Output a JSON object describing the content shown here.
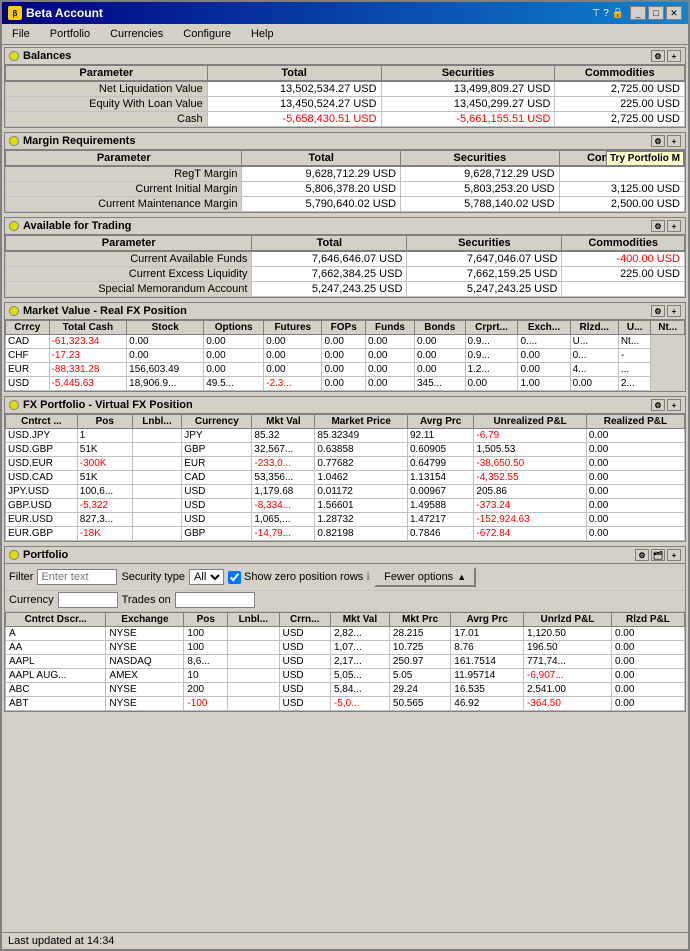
{
  "window": {
    "title": "Beta Account",
    "icon": "β"
  },
  "menu": {
    "items": [
      "File",
      "Portfolio",
      "Currencies",
      "Configure",
      "Help"
    ]
  },
  "balances": {
    "title": "Balances",
    "headers": [
      "Parameter",
      "Total",
      "Securities",
      "Commodities"
    ],
    "rows": [
      [
        "Net Liquidation Value",
        "13,502,534.27 USD",
        "13,499,809.27 USD",
        "2,725.00 USD"
      ],
      [
        "Equity With Loan Value",
        "13,450,524.27 USD",
        "13,450,299.27 USD",
        "225.00 USD"
      ],
      [
        "Cash",
        "-5,658,430.51 USD",
        "-5,661,155.51 USD",
        "2,725.00 USD"
      ]
    ]
  },
  "margin": {
    "title": "Margin Requirements",
    "headers": [
      "Parameter",
      "Total",
      "Securities",
      "Commodities"
    ],
    "try_portfolio": "Try Portfolio M",
    "rows": [
      [
        "RegT Margin",
        "9,628,712.29 USD",
        "9,628,712.29 USD",
        ""
      ],
      [
        "Current Initial Margin",
        "5,806,378.20 USD",
        "5,803,253.20 USD",
        "3,125.00 USD"
      ],
      [
        "Current Maintenance Margin",
        "5,790,640.02 USD",
        "5,788,140.02 USD",
        "2,500.00 USD"
      ]
    ]
  },
  "available": {
    "title": "Available for Trading",
    "headers": [
      "Parameter",
      "Total",
      "Securities",
      "Commodities"
    ],
    "rows": [
      [
        "Current Available Funds",
        "7,646,646.07 USD",
        "7,647,046.07 USD",
        "-400.00 USD"
      ],
      [
        "Current Excess Liquidity",
        "7,662,384.25 USD",
        "7,662,159.25 USD",
        "225.00 USD"
      ],
      [
        "Special Memorandum Account",
        "5,247,243.25 USD",
        "5,247,243.25 USD",
        ""
      ]
    ]
  },
  "market_value": {
    "title": "Market Value - Real FX Position",
    "headers": [
      "Crrcy",
      "Total Cash",
      "Stock",
      "Options",
      "Futures",
      "FOPs",
      "Funds",
      "Bonds",
      "Crprt...",
      "Exch...",
      "Rlzd...",
      "U...",
      "Nt..."
    ],
    "rows": [
      [
        "CAD",
        "-61,323.34",
        "0.00",
        "0.00",
        "0.00",
        "0.00",
        "0.00",
        "0.00",
        "0.9...",
        "0....",
        "U...",
        "Nt..."
      ],
      [
        "CHF",
        "-17.23",
        "0.00",
        "0.00",
        "0.00",
        "0.00",
        "0.00",
        "0.00",
        "0.9...",
        "0.00",
        "0...",
        "-"
      ],
      [
        "EUR",
        "-88,331.28",
        "156,603.49",
        "0.00",
        "0.00",
        "0.00",
        "0.00",
        "0.00",
        "1.2...",
        "0.00",
        "4...",
        "..."
      ],
      [
        "USD",
        "-5,445.63",
        "18,906.9...",
        "49.5...",
        "-2.3...",
        "0.00",
        "0.00",
        "345...",
        "0.00",
        "1.00",
        "0.00",
        "2...",
        "..."
      ]
    ]
  },
  "fx_portfolio": {
    "title": "FX Portfolio - Virtual FX Position",
    "headers": [
      "Cntrct ...",
      "Pos",
      "Lnbl...",
      "Currency",
      "Mkt Val",
      "Market Price",
      "Avrg Prc",
      "Unrealized P&L",
      "Realized P&L"
    ],
    "rows": [
      [
        "USD.JPY",
        "1",
        "",
        "JPY",
        "85.32",
        "85.32349",
        "92.11",
        "-6.79",
        "0.00"
      ],
      [
        "USD.GBP",
        "51K",
        "",
        "GBP",
        "32,567...",
        "0.63858",
        "0.60905",
        "1,505.53",
        "0.00"
      ],
      [
        "USD.EUR",
        "-300K",
        "",
        "EUR",
        "-233,0...",
        "0.77682",
        "0.64799",
        "-38,650.50",
        "0.00"
      ],
      [
        "USD.CAD",
        "51K",
        "",
        "CAD",
        "53,356...",
        "1.0462",
        "1.13154",
        "-4,352.55",
        "0.00"
      ],
      [
        "JPY.USD",
        "100,6...",
        "",
        "USD",
        "1,179.68",
        "0.01172",
        "0.00967",
        "205.86",
        "0.00"
      ],
      [
        "GBP.USD",
        "-5,322",
        "",
        "USD",
        "-8,334...",
        "1.56601",
        "1.49588",
        "-373.24",
        "0.00"
      ],
      [
        "EUR.USD",
        "827,3...",
        "",
        "USD",
        "1,065,...",
        "1.28732",
        "1.47217",
        "-152,924.63",
        "0.00"
      ],
      [
        "EUR.GBP",
        "-18K",
        "",
        "GBP",
        "-14,79...",
        "0.82198",
        "0.7846",
        "-672.84",
        "0.00"
      ]
    ]
  },
  "portfolio": {
    "title": "Portfolio",
    "filter": {
      "filter_label": "Filter",
      "filter_placeholder": "Enter text",
      "security_type_label": "Security type",
      "security_type_value": "All",
      "show_zero_label": "Show zero position rows",
      "currency_label": "Currency",
      "trades_on_label": "Trades on",
      "fewer_options_label": "Fewer options"
    },
    "headers": [
      "Cntrct Dscr...",
      "Exchange",
      "Pos",
      "Lnbl...",
      "Crrn...",
      "Mkt Val",
      "Mkt Prc",
      "Avrg Prc",
      "Unrlzd P&L",
      "Rlzd P&L"
    ],
    "rows": [
      [
        "A",
        "NYSE",
        "100",
        "",
        "USD",
        "2,82...",
        "28.215",
        "17.01",
        "1,120.50",
        "0.00"
      ],
      [
        "AA",
        "NYSE",
        "100",
        "",
        "USD",
        "1,07...",
        "10.725",
        "8.76",
        "196.50",
        "0.00"
      ],
      [
        "AAPL",
        "NASDAQ",
        "8,6...",
        "",
        "USD",
        "2,17...",
        "250.97",
        "161.7514",
        "771,74...",
        "0.00"
      ],
      [
        "AAPL AUG...",
        "AMEX",
        "10",
        "",
        "USD",
        "5,05...",
        "5.05",
        "11.95714",
        "-6,907...",
        "0.00"
      ],
      [
        "ABC",
        "NYSE",
        "200",
        "",
        "USD",
        "5,84...",
        "29.24",
        "16.535",
        "2,541.00",
        "0.00"
      ],
      [
        "ABT",
        "NYSE",
        "-100",
        "",
        "USD",
        "-5,0...",
        "50.565",
        "46.92",
        "-364.50",
        "0.00"
      ]
    ]
  },
  "status_bar": {
    "text": "Last updated at 14:34"
  }
}
